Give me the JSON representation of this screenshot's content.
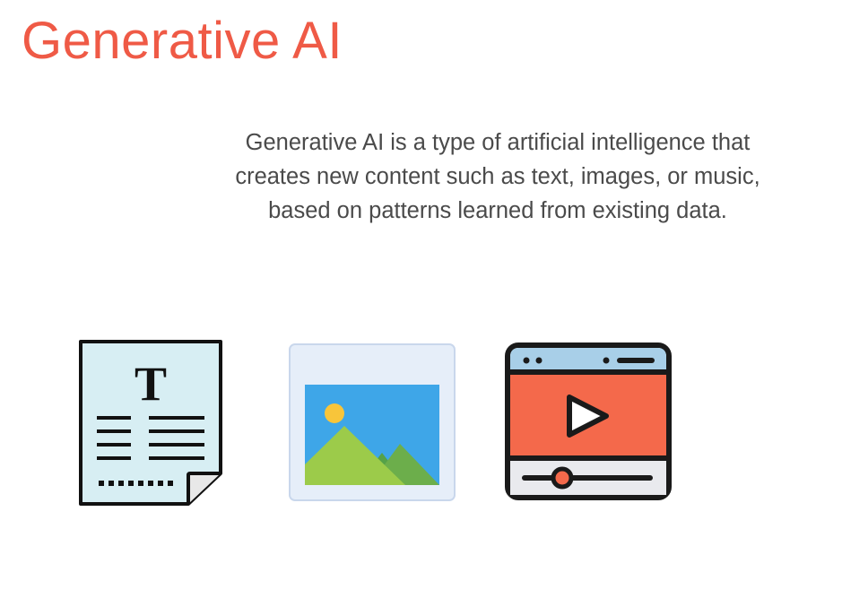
{
  "slide": {
    "title": "Generative AI",
    "description_lines": [
      "Generative AI is a type of artificial intelligence that",
      "creates new content such as text, images, or music,",
      "based on patterns learned from existing data."
    ]
  },
  "icons": [
    {
      "name": "text-document-icon",
      "glyph": "T"
    },
    {
      "name": "image-landscape-icon"
    },
    {
      "name": "video-player-icon"
    }
  ],
  "colors": {
    "title": "#ef5a46",
    "body_text": "#4a4a4a",
    "document_fill": "#d7eef3",
    "image_frame": "#e6eef9",
    "image_sky": "#3ea6e8",
    "image_sun": "#f8c53a",
    "image_mountain": "#9ccb4a",
    "video_screen": "#f4694b",
    "video_bar": "#a8cfe8"
  }
}
